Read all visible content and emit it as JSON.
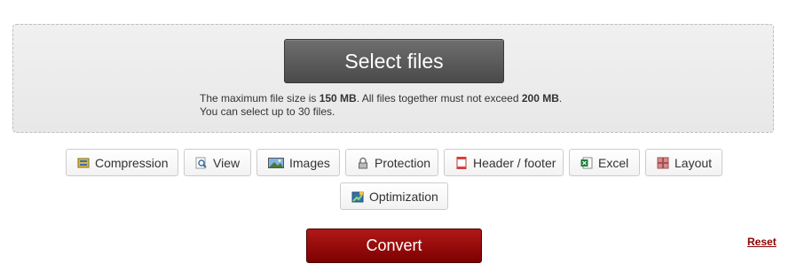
{
  "upload": {
    "select_label": "Select files",
    "info_prefix": "The maximum file size is ",
    "max_file_size": "150 MB",
    "info_middle": ". All files together must not exceed ",
    "max_total_size": "200 MB",
    "info_suffix": ".",
    "info_line2": "You can select up to 30 files."
  },
  "options": [
    {
      "label": "Compression",
      "icon": "compression-icon"
    },
    {
      "label": "View",
      "icon": "view-magnifier-icon"
    },
    {
      "label": "Images",
      "icon": "images-icon"
    },
    {
      "label": "Protection",
      "icon": "lock-icon"
    },
    {
      "label": "Header / footer",
      "icon": "header-footer-icon"
    },
    {
      "label": "Excel",
      "icon": "excel-icon"
    },
    {
      "label": "Layout",
      "icon": "layout-icon"
    },
    {
      "label": "Optimization",
      "icon": "optimization-icon"
    }
  ],
  "actions": {
    "convert_label": "Convert",
    "reset_label": "Reset"
  },
  "colors": {
    "convert": "#9b0a0a",
    "select": "#5a5a5a",
    "reset_link": "#8b0000"
  }
}
